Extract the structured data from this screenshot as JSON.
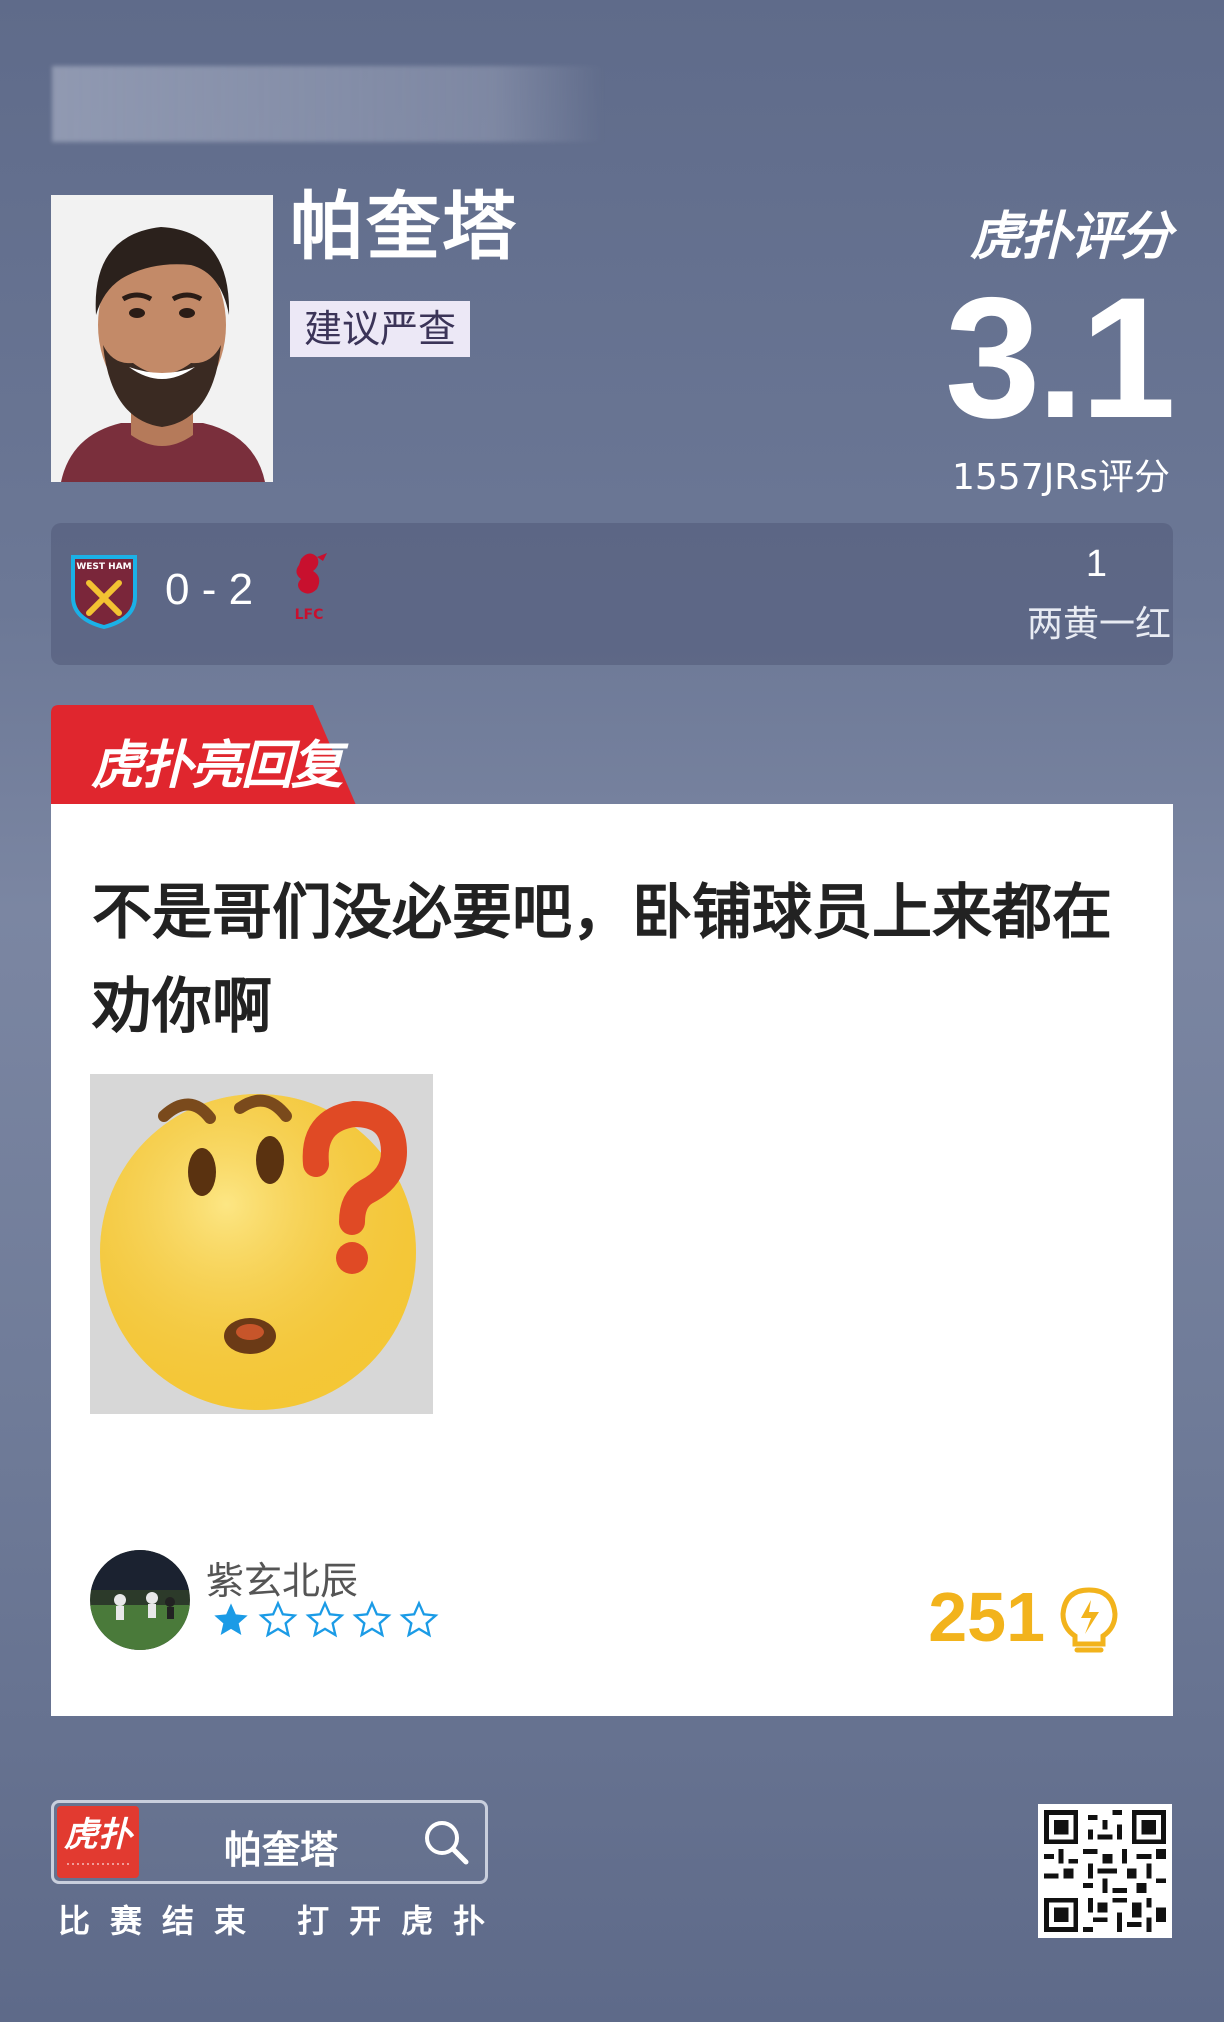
{
  "player": {
    "name": "帕奎塔",
    "verdict_tag": "建议严查"
  },
  "rating": {
    "brand_logo": "虎扑评分",
    "score": "3.1",
    "count": "1557JRs评分"
  },
  "match": {
    "home_team_crest": "west-ham-crest",
    "score": "0 - 2",
    "away_team_crest": "liverpool-crest",
    "card_count": "1",
    "card_desc": "两黄一红"
  },
  "highlight": {
    "tab_label": "虎扑亮回复"
  },
  "comment": {
    "text": "不是哥们没必要吧，卧铺球员上来都在劝你啊",
    "emoji": "confused-question-emoji",
    "username": "紫玄北辰",
    "stars": 1,
    "stars_max": 5,
    "likes": "251",
    "star_color": "#1b9be6",
    "likes_color": "#f2b31c"
  },
  "footer": {
    "app_icon_label": "虎扑",
    "search_term": "帕奎塔",
    "cta": "比赛结束 打开虎扑"
  },
  "colors": {
    "accent_red": "#e23a30",
    "tag_bg": "#ece8f6"
  }
}
